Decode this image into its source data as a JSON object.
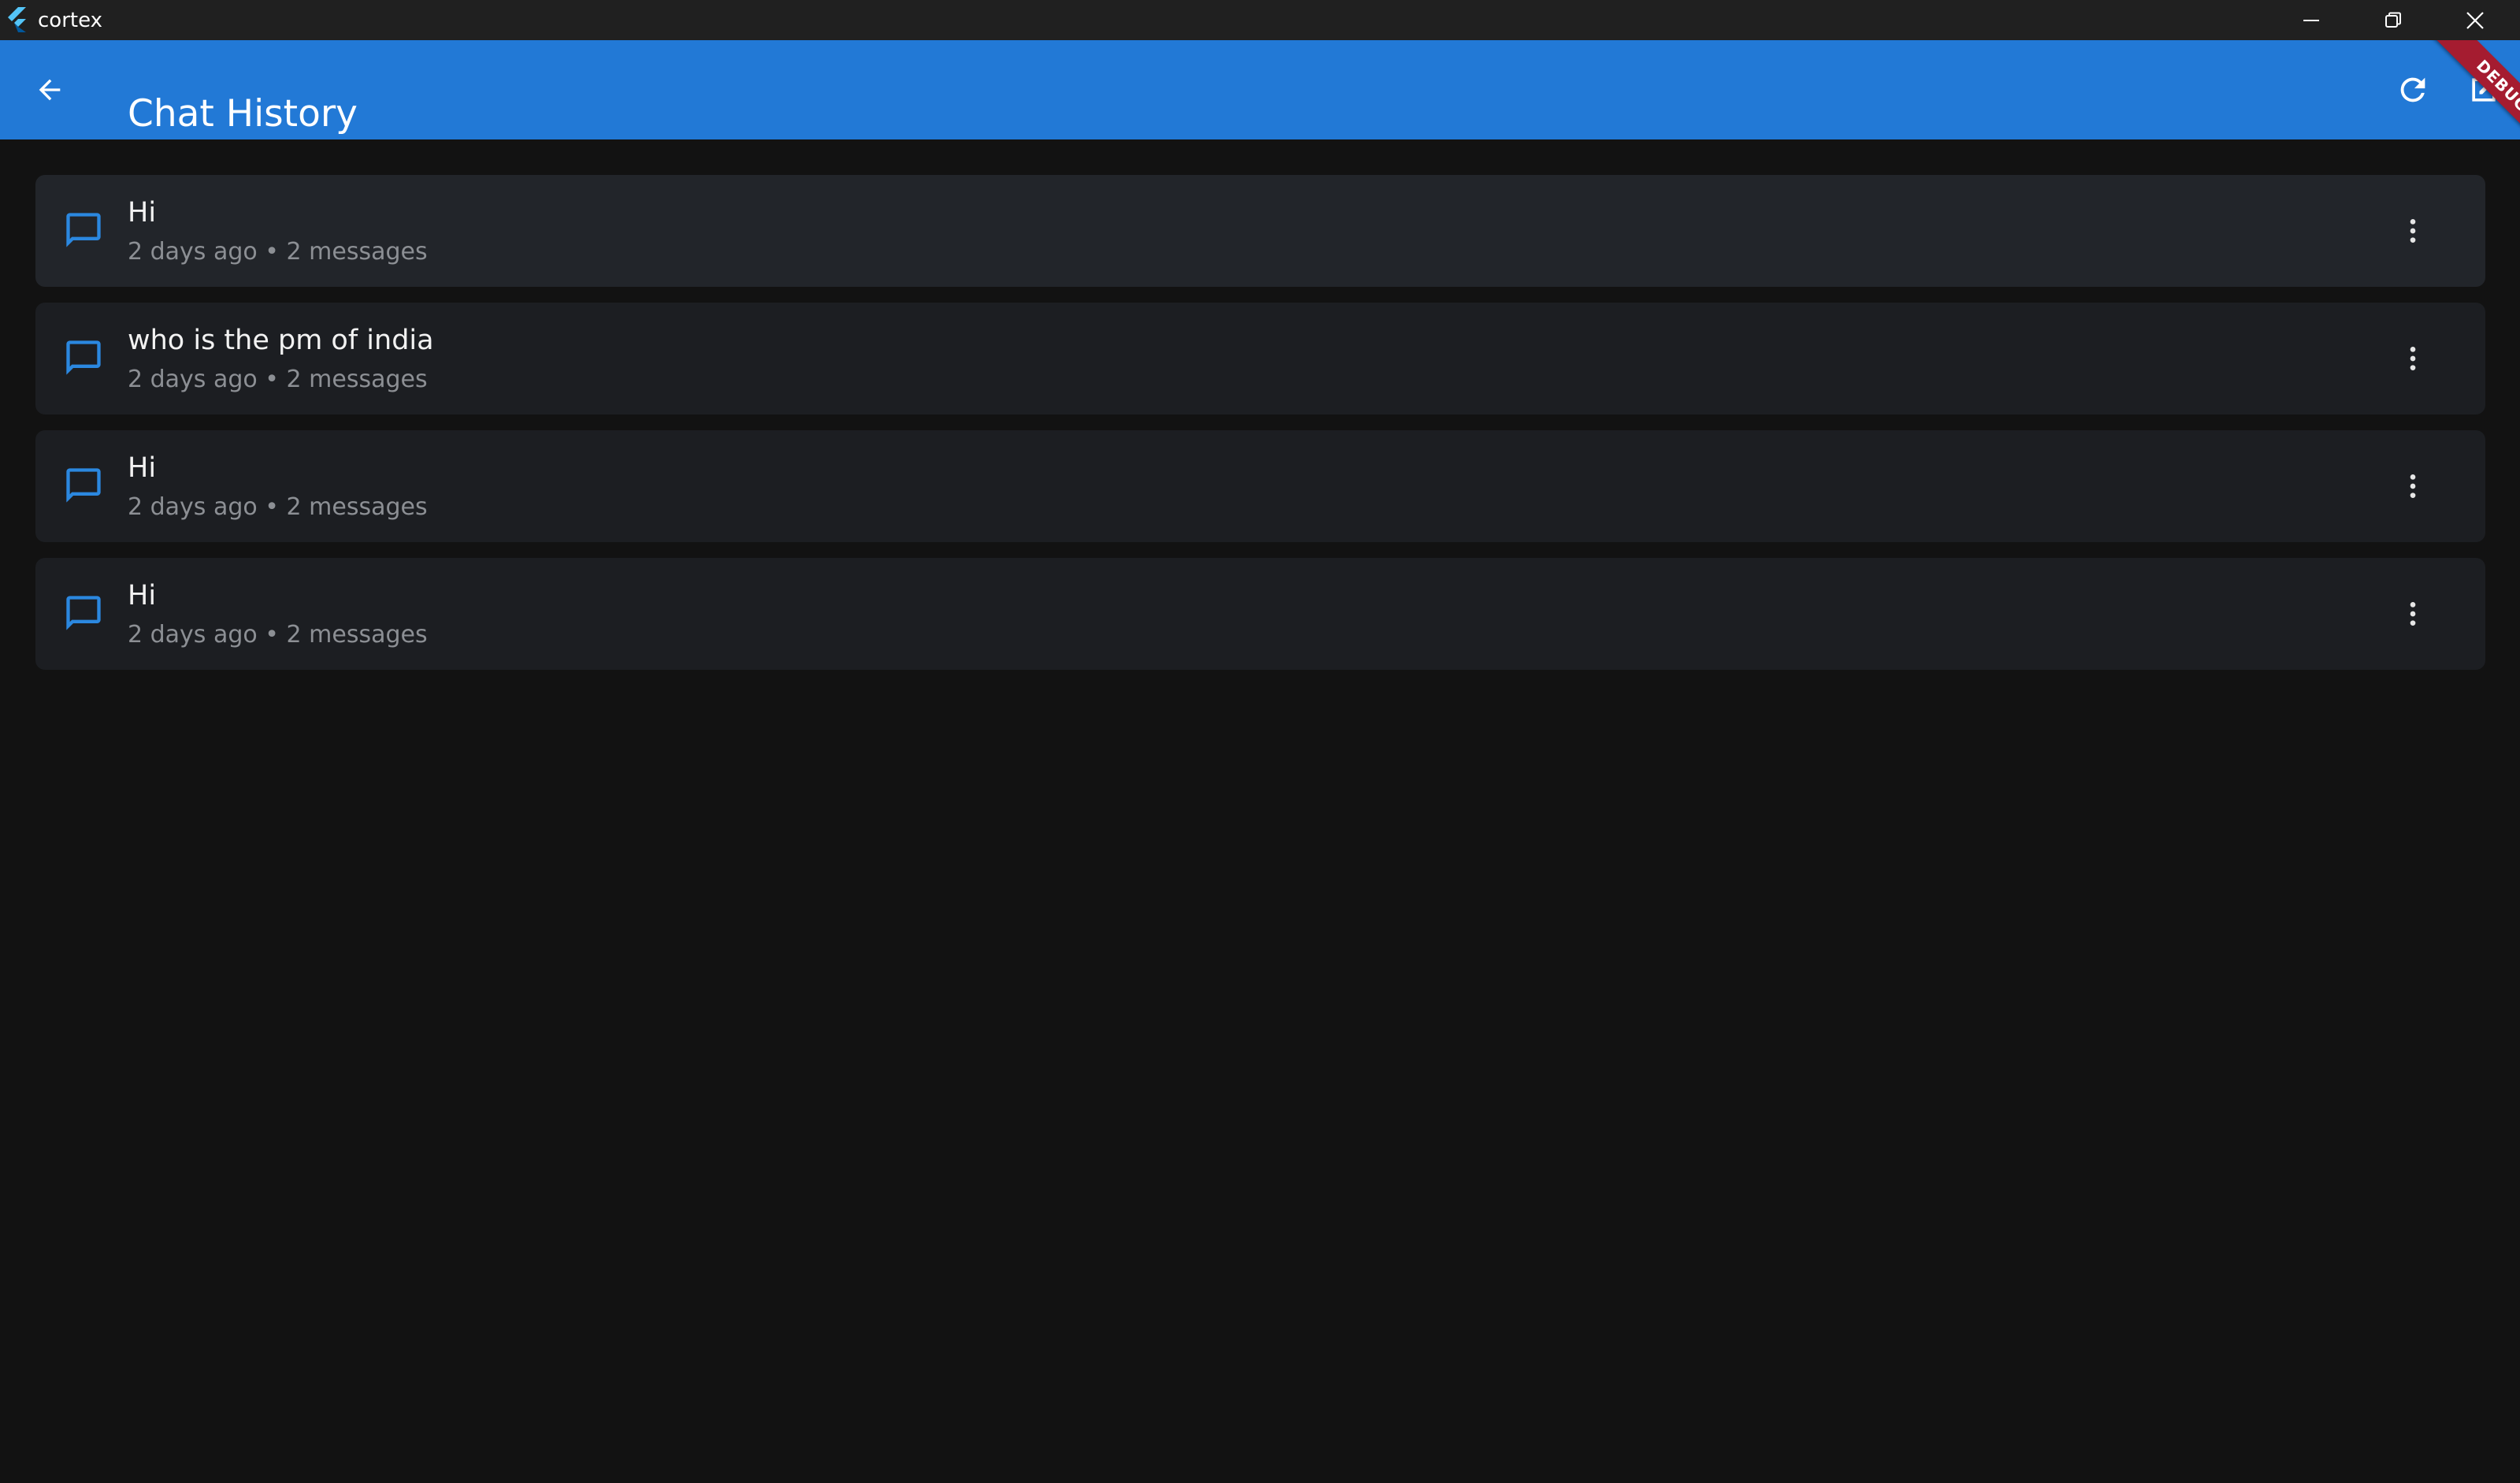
{
  "window": {
    "title": "cortex",
    "controls": [
      "minimize-icon",
      "restore-icon",
      "close-icon"
    ]
  },
  "appbar": {
    "title": "Chat History",
    "back_icon": "arrow-back-icon",
    "actions": [
      "refresh-icon",
      "new-chat-icon"
    ],
    "color": "#2279d6"
  },
  "debug_banner": {
    "label": "DEBUG"
  },
  "chats": [
    {
      "title": "Hi",
      "time": "2 days ago",
      "separator": " • ",
      "count": "2 messages"
    },
    {
      "title": "who is the pm of india",
      "time": "2 days ago",
      "separator": " • ",
      "count": "2 messages"
    },
    {
      "title": "Hi",
      "time": "2 days ago",
      "separator": " • ",
      "count": "2 messages"
    },
    {
      "title": "Hi",
      "time": "2 days ago",
      "separator": " • ",
      "count": "2 messages"
    }
  ],
  "colors": {
    "background": "#121212",
    "card": "#1c1e22",
    "accent": "#2b88e0",
    "subtitle": "#8c8f94"
  }
}
